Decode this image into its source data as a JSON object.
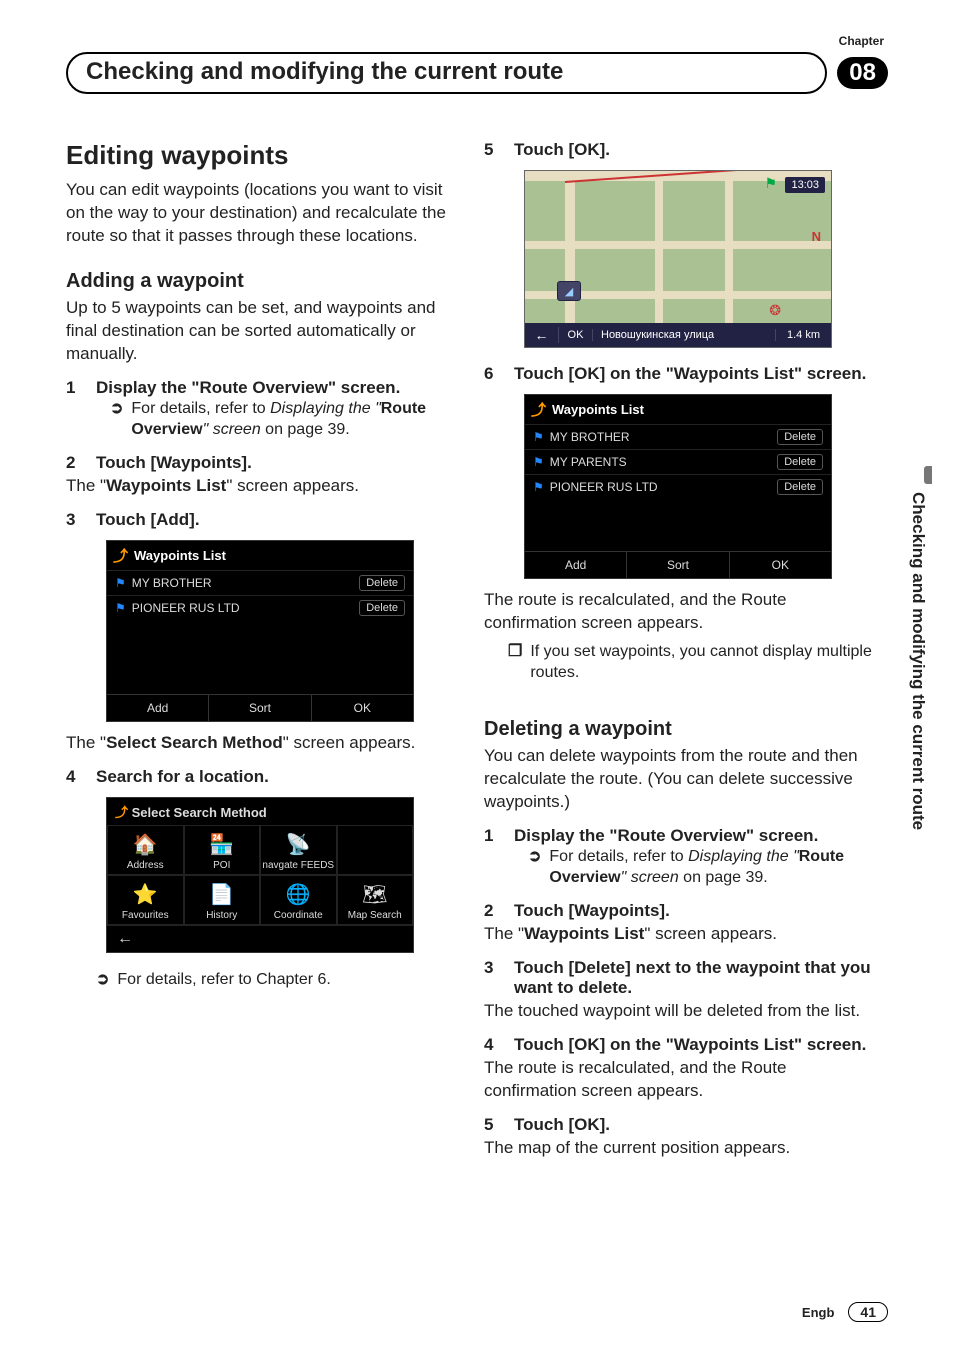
{
  "chapter_label": "Chapter",
  "chapter_number": "08",
  "header_title": "Checking and modifying the current route",
  "side_tab": "Checking and modifying the current route",
  "footer": {
    "lang": "Engb",
    "page": "41"
  },
  "h1": "Editing waypoints",
  "intro": "You can edit waypoints (locations you want to visit on the way to your destination) and recalculate the route so that it passes through these locations.",
  "h2_add": "Adding a waypoint",
  "add_intro": "Up to 5 waypoints can be set, and waypoints and final destination can be sorted automatically or manually.",
  "add_steps": {
    "s1": "Display the \"Route Overview\" screen.",
    "s1_sub_pre": "For details, refer to ",
    "s1_sub_ital": "Displaying the \"",
    "s1_sub_bold": "Route Overview",
    "s1_sub_ital2": "\" screen",
    "s1_sub_post": " on page 39.",
    "s2": "Touch [Waypoints].",
    "s2_after_pre": "The \"",
    "s2_after_bold": "Waypoints List",
    "s2_after_post": "\" screen appears.",
    "s3": "Touch [Add].",
    "s3_after_pre": "The \"",
    "s3_after_bold": "Select Search Method",
    "s3_after_post": "\" screen appears.",
    "s4": "Search for a location.",
    "s4_sub": "For details, refer to Chapter 6.",
    "s5": "Touch [OK].",
    "s6": "Touch [OK] on the \"Waypoints List\" screen.",
    "s6_after": "The route is recalculated, and the Route confirmation screen appears.",
    "s6_note": "If you set waypoints, you cannot display multiple routes."
  },
  "h2_del": "Deleting a waypoint",
  "del_intro": "You can delete waypoints from the route and then recalculate the route. (You can delete successive waypoints.)",
  "del_steps": {
    "s1": "Display the \"Route Overview\" screen.",
    "s1_sub_pre": "For details, refer to ",
    "s1_sub_ital": "Displaying the \"",
    "s1_sub_bold": "Route Overview",
    "s1_sub_ital2": "\" screen",
    "s1_sub_post": " on page 39.",
    "s2": "Touch [Waypoints].",
    "s2_after_pre": "The \"",
    "s2_after_bold": "Waypoints List",
    "s2_after_post": "\" screen appears.",
    "s3": "Touch [Delete] next to the waypoint that you want to delete.",
    "s3_after": "The touched waypoint will be deleted from the list.",
    "s4": "Touch [OK] on the \"Waypoints List\" screen.",
    "s4_after": "The route is recalculated, and the Route confirmation screen appears.",
    "s5": "Touch [OK].",
    "s5_after": "The map of the current position appears."
  },
  "shot_wp1": {
    "title": "Waypoints List",
    "rows": [
      {
        "name": "MY BROTHER",
        "btn": "Delete"
      },
      {
        "name": "PIONEER RUS LTD",
        "btn": "Delete"
      }
    ],
    "buttons": [
      "Add",
      "Sort",
      "OK"
    ]
  },
  "shot_wp2": {
    "title": "Waypoints List",
    "rows": [
      {
        "name": "MY BROTHER",
        "btn": "Delete"
      },
      {
        "name": "MY PARENTS",
        "btn": "Delete"
      },
      {
        "name": "PIONEER RUS LTD",
        "btn": "Delete"
      }
    ],
    "buttons": [
      "Add",
      "Sort",
      "OK"
    ]
  },
  "shot_ssm": {
    "title": "Select Search Method",
    "cells": [
      {
        "icon": "🏠",
        "label": "Address"
      },
      {
        "icon": "🏪",
        "label": "POI"
      },
      {
        "icon": "📡",
        "label": "navgate FEEDS"
      },
      {
        "icon": "",
        "label": ""
      },
      {
        "icon": "⭐",
        "label": "Favourites"
      },
      {
        "icon": "📄",
        "label": "History"
      },
      {
        "icon": "🌐",
        "label": "Coordinate"
      },
      {
        "icon": "🗺",
        "label": "Map Search"
      }
    ],
    "back": "←"
  },
  "shot_map": {
    "time": "13:03",
    "north": "N",
    "ok": "OK",
    "back": "←",
    "street": "Новошукинская улица",
    "dist": "1.4 km"
  }
}
